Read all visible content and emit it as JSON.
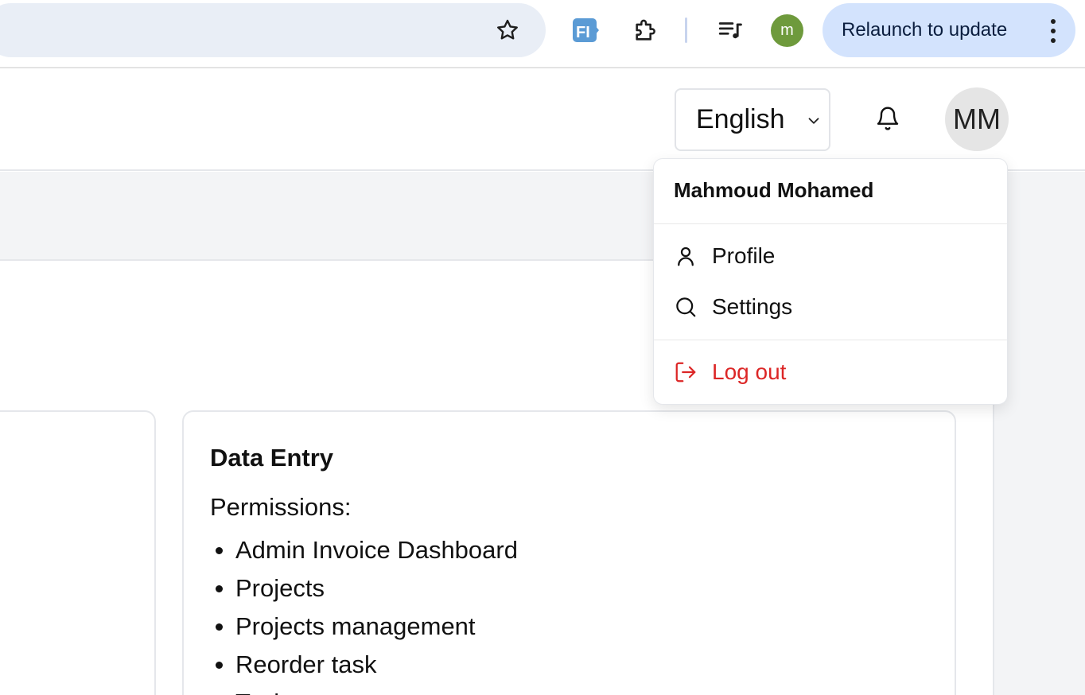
{
  "browser": {
    "extension_fi_label": "FI",
    "profile_initial": "m",
    "relaunch_label": "Relaunch to update",
    "icons": [
      "star-icon",
      "fi-extension-icon",
      "puzzle-icon",
      "media-queue-icon",
      "more-vert-icon"
    ],
    "colors": {
      "omnibox_bg": "#e9eef6",
      "relaunch_bg": "#d3e3fd",
      "profile_bg": "#6e9a3c"
    }
  },
  "header": {
    "language": {
      "selected": "English"
    },
    "avatar_initials": "MM"
  },
  "user_menu": {
    "name": "Mahmoud Mohamed",
    "items": [
      {
        "label": "Profile",
        "icon": "user-icon"
      },
      {
        "label": "Settings",
        "icon": "search-icon"
      },
      {
        "label": "Log out",
        "icon": "logout-icon",
        "color": "#dc2626"
      }
    ]
  },
  "role_card": {
    "title": "Data Entry",
    "permissions_label": "Permissions:",
    "permissions": [
      "Admin Invoice Dashboard",
      "Projects",
      "Projects management",
      "Reorder task",
      "Tasks"
    ]
  }
}
